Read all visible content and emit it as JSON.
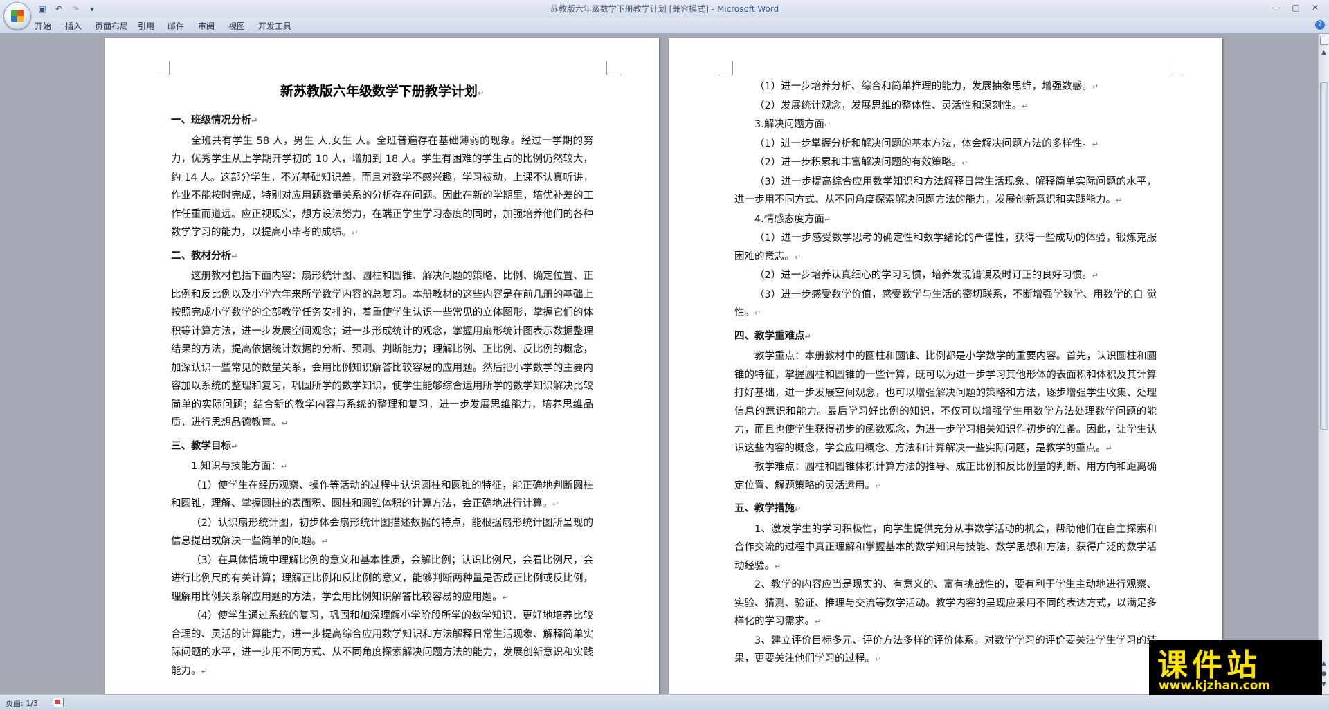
{
  "window": {
    "title_doc": "苏教版六年级数学下册教学计划 [兼容模式]",
    "title_sep": " - ",
    "title_app": "Microsoft Word"
  },
  "ribbon": {
    "tabs": [
      "开始",
      "插入",
      "页面布局",
      "引用",
      "邮件",
      "审阅",
      "视图",
      "开发工具"
    ]
  },
  "status": {
    "page": "页面: 1/3"
  },
  "watermark": {
    "text": "课件站",
    "url": "www.kjzhan.com"
  },
  "paragraph_mark": "↵",
  "document": {
    "left_page": {
      "title": "新苏教版六年级数学下册教学计划",
      "blocks": [
        {
          "type": "h",
          "text": "一、班级情况分析"
        },
        {
          "type": "p",
          "text": "全班共有学生 58 人，男生  人,女生 人。全班普遍存在基础薄弱的现象。经过一学期的努力，优秀学生从上学期开学初的 10 人，增加到 18 人。学生有困难的学生占的比例仍然较大，约 14 人。这部分学生，不光基础知识差，而且对数学不感兴趣，学习被动，上课不认真听讲，作业不能按时完成，特别对应用题数量关系的分析存在问题。因此在新的学期里，培优补差的工作任重而道远。应正视现实，想方设法努力，在端正学生学习态度的同时，加强培养他们的各种数学学习的能力，以提高小毕考的成绩。"
        },
        {
          "type": "h",
          "text": "二、教材分析"
        },
        {
          "type": "p",
          "text": "这册教材包括下面内容：扇形统计图、圆柱和圆锥、解决问题的策略、比例、确定位置、正比例和反比例以及小学六年来所学数学内容的总复习。本册教材的这些内容是在前几册的基础上按照完成小学数学的全部教学任务安排的，着重使学生认识一些常见的立体图形，掌握它们的体积等计算方法，进一步发展空间观念；进一步形成统计的观念，掌握用扇形统计图表示数据整理结果的方法，提高依据统计数据的分析、预测、判断能力；理解比例、正比例、反比例的概念，加深认识一些常见的数量关系，会用比例知识解答比较容易的应用题。然后把小学数学的主要内容加以系统的整理和复习，巩固所学的数学知识，使学生能够综合运用所学的数学知识解决比较简单的实际问题；结合新的教学内容与系统的整理和复习，进一步发展思维能力，培养思维品质，进行思想品德教育。"
        },
        {
          "type": "h",
          "text": "三、教学目标"
        },
        {
          "type": "p",
          "text": "1.知识与技能方面："
        },
        {
          "type": "p",
          "text": "（1）使学生在经历观察、操作等活动的过程中认识圆柱和圆锥的特征，能正确地判断圆柱和圆锥，理解、掌握圆柱的表面积、圆柱和圆锥体积的计算方法，会正确地进行计算。"
        },
        {
          "type": "p",
          "text": "（2）认识扇形统计图，初步体会扇形统计图描述数据的特点，能根据扇形统计图所呈现的信息提出或解决一些简单的问题。"
        },
        {
          "type": "p",
          "text": "（3）在具体情境中理解比例的意义和基本性质，会解比例；认识比例尺，会看比例尺，会进行比例尺的有关计算；理解正比例和反比例的意义，能够判断两种量是否成正比例或反比例，理解用比例关系解应用题的方法，学会用比例知识解答比较容易的应用题。"
        },
        {
          "type": "p",
          "text": "（4）使学生通过系统的复习，巩固和加深理解小学阶段所学的数学知识，更好地培养比较合理的、灵活的计算能力，进一步提高综合应用数学知识和方法解释日常生活现象、解释简单实际问题的水平，进一步用不同方式、从不同角度探索解决问题方法的能力，发展创新意识和实践能力。"
        }
      ]
    },
    "right_page": {
      "blocks": [
        {
          "type": "p",
          "text": "（1）进一步培养分析、综合和简单推理的能力，发展抽象思维，增强数感。"
        },
        {
          "type": "p",
          "text": "（2）发展统计观念，发展思维的整体性、灵活性和深刻性。"
        },
        {
          "type": "p",
          "text": "3.解决问题方面"
        },
        {
          "type": "p",
          "text": "（1）进一步掌握分析和解决问题的基本方法，体会解决问题方法的多样性。"
        },
        {
          "type": "p",
          "text": "（2）进一步积累和丰富解决问题的有效策略。"
        },
        {
          "type": "p",
          "text": "（3）进一步提高综合应用数学知识和方法解释日常生活现象、解释简单实际问题的水平，进一步用不同方式、从不同角度探索解决问题方法的能力，发展创新意识和实践能力。"
        },
        {
          "type": "p",
          "text": "4.情感态度方面"
        },
        {
          "type": "p",
          "text": "（1）进一步感受数学思考的确定性和数学结论的严谨性，获得一些成功的体验，锻炼克服困难的意志。"
        },
        {
          "type": "p",
          "text": "（2）进一步培养认真细心的学习习惯，培养发现错误及时订正的良好习惯。"
        },
        {
          "type": "p",
          "text": "（3）进一步感受数学价值，感受数学与生活的密切联系，不断增强学数学、用数学的自 觉性。"
        },
        {
          "type": "h",
          "text": "四、教学重难点"
        },
        {
          "type": "p",
          "text": "教学重点：本册教材中的圆柱和圆锥、比例都是小学数学的重要内容。首先，认识圆柱和圆锥的特征，掌握圆柱和圆锥的一些计算，既可以为进一步学习其他形体的表面积和体积及其计算打好基础，进一步发展空间观念，也可以增强解决问题的策略和方法，逐步增强学生收集、处理信息的意识和能力。最后学习好比例的知识，不仅可以增强学生用数学方法处理数学问题的能力，而且也使学生获得初步的函数观念，为进一步学习相关知识作初步的准备。因此，让学生认识这些内容的概念，学会应用概念、方法和计算解决一些实际问题，是教学的重点。"
        },
        {
          "type": "p",
          "text": "教学难点：圆柱和圆锥体积计算方法的推导、成正比例和反比例量的判断、用方向和距离确定位置、解题策略的灵活运用。"
        },
        {
          "type": "h",
          "text": "五、教学措施"
        },
        {
          "type": "p",
          "text": "1、激发学生的学习积极性，向学生提供充分从事数学活动的机会，帮助他们在自主探索和合作交流的过程中真正理解和掌握基本的数学知识与技能、数学思想和方法，获得广泛的数学活动经验。"
        },
        {
          "type": "p",
          "text": "2、教学的内容应当是现实的、有意义的、富有挑战性的，要有利于学生主动地进行观察、实验、猜测、验证、推理与交流等数学活动。教学内容的呈现应采用不同的表达方式，以满足多样化的学习需求。"
        },
        {
          "type": "p",
          "text": "3、建立评价目标多元、评价方法多样的评价体系。对数学学习的评价要关注学生学习的结果，更要关注他们学习的过程。"
        }
      ]
    }
  }
}
